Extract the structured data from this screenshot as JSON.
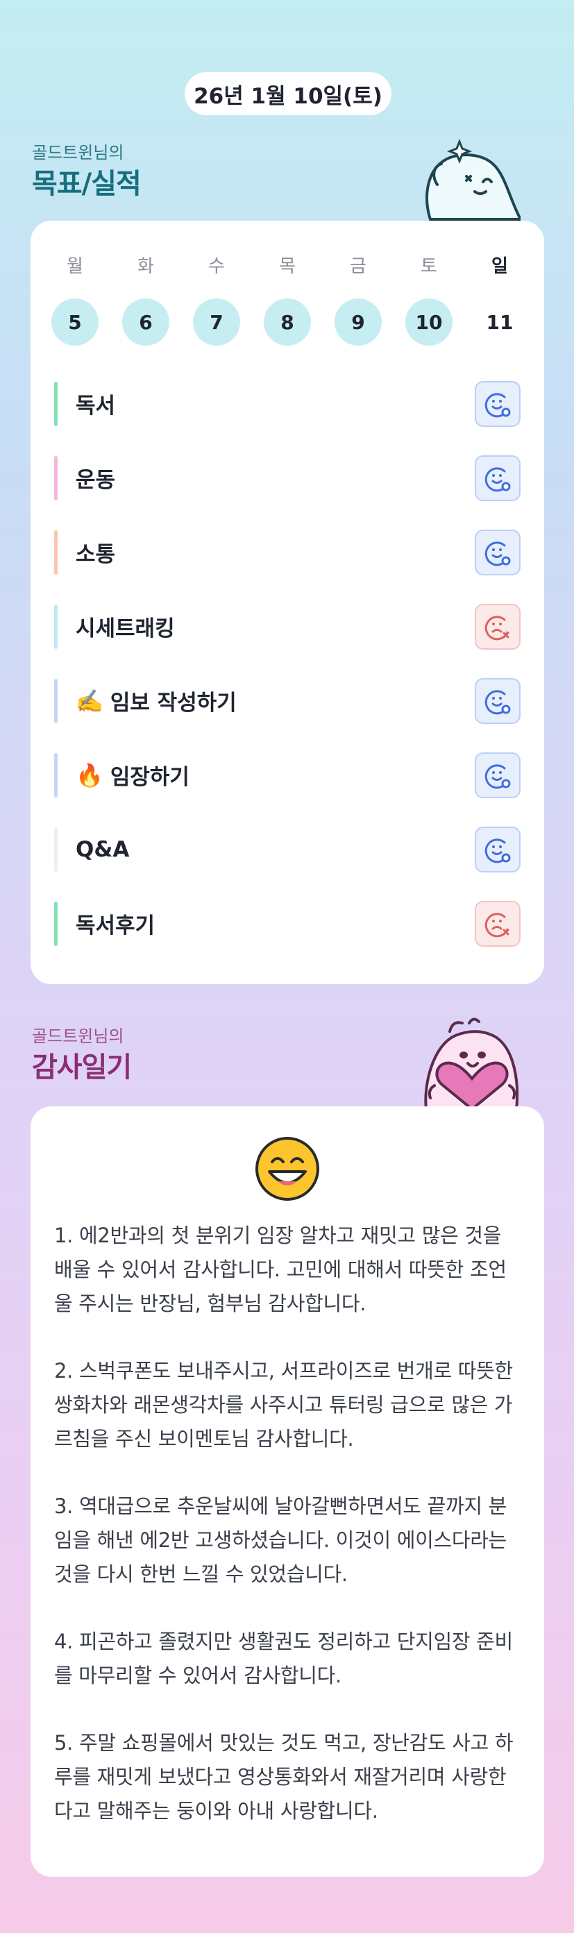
{
  "date": "26년 1월 10일(토)",
  "goals_section": {
    "subtitle": "골드트윈님의",
    "title": "목표/실적"
  },
  "week": [
    {
      "day": "월",
      "num": "5",
      "marked": true
    },
    {
      "day": "화",
      "num": "6",
      "marked": true
    },
    {
      "day": "수",
      "num": "7",
      "marked": true
    },
    {
      "day": "목",
      "num": "8",
      "marked": true
    },
    {
      "day": "금",
      "num": "9",
      "marked": true
    },
    {
      "day": "토",
      "num": "10",
      "marked": true
    },
    {
      "day": "일",
      "num": "11",
      "marked": false
    }
  ],
  "goals": [
    {
      "label": "독서",
      "bar_color": "#86e0b6",
      "status": "done",
      "icon": "smile-check-icon"
    },
    {
      "label": "운동",
      "bar_color": "#f5b8dc",
      "status": "done",
      "icon": "smile-check-icon"
    },
    {
      "label": "소통",
      "bar_color": "#f9c6b3",
      "status": "done",
      "icon": "smile-check-icon"
    },
    {
      "label": "시세트래킹",
      "bar_color": "#bfe9f3",
      "status": "fail",
      "icon": "sad-x-icon"
    },
    {
      "label": "임보 작성하기",
      "emoji": "✍️",
      "bar_color": "#c8d4f4",
      "status": "done",
      "icon": "smile-check-icon"
    },
    {
      "label": "임장하기",
      "emoji": "🔥",
      "bar_color": "#c8d4f4",
      "status": "done",
      "icon": "smile-check-icon"
    },
    {
      "label": "Q&A",
      "bar_color": "#eceef2",
      "status": "done",
      "icon": "smile-check-icon"
    },
    {
      "label": "독서후기",
      "bar_color": "#86e0b6",
      "status": "fail",
      "icon": "sad-x-icon"
    }
  ],
  "gratitude_section": {
    "subtitle": "골드트윈님의",
    "title": "감사일기"
  },
  "mood_icon": "grinning-face-icon",
  "diary": [
    "1. 에2반과의 첫 분위기 임장 알차고 재밋고 많은 것을 배울 수 있어서 감사합니다. 고민에 대해서 따뜻한 조언울 주시는 반장님, 험부님 감사합니다.",
    "2. 스벅쿠폰도 보내주시고, 서프라이즈로 번개로 따뜻한 쌍화차와 래몬생각차를 사주시고 튜터링 급으로 많은 가르침을 주신 보이멘토님 감사합니다.",
    "3. 역대급으로 추운날씨에 날아갈뻔하면서도 끝까지 분임을 해낸 에2반 고생하셨습니다. 이것이 에이스다라는 것을 다시 한번 느낄 수 있었습니다.",
    "4. 피곤하고 졸렸지만 생활권도 정리하고 단지임장 준비를 마무리할 수 있어서 감사합니다.",
    "5. 주말 쇼핑몰에서 맛있는 것도 먹고, 장난감도 사고 하루를 재밋게 보냈다고 영상통화와서 재잘거리며 사랑한다고 말해주는 둥이와 아내 사랑합니다."
  ]
}
